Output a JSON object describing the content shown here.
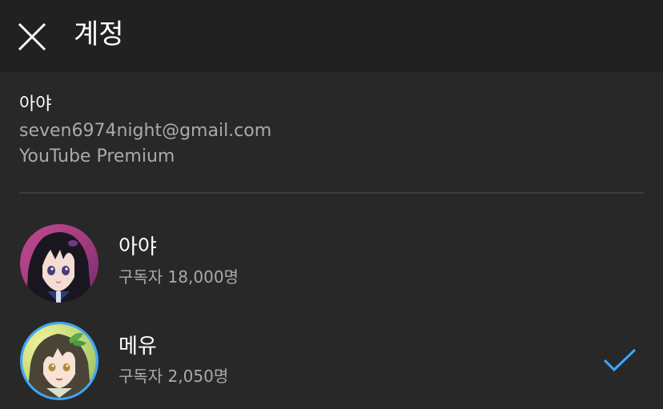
{
  "header": {
    "title": "계정",
    "close_icon": "close-icon"
  },
  "account": {
    "name": "아야",
    "email": "seven6974night@gmail.com",
    "membership": "YouTube Premium"
  },
  "channels": [
    {
      "name": "아야",
      "subscribers": "구독자 18,000명",
      "avatar_icon": "avatar-anime-girl-dark-hair",
      "selected": false
    },
    {
      "name": "메유",
      "subscribers": "구독자 2,050명",
      "avatar_icon": "avatar-anime-girl-leaf",
      "selected": true
    }
  ],
  "colors": {
    "header_bg": "#212121",
    "page_bg": "#282828",
    "primary_text": "#ffffff",
    "secondary_text": "#aaaaaa",
    "accent": "#3ea6ff",
    "divider": "#3d3d3d"
  }
}
